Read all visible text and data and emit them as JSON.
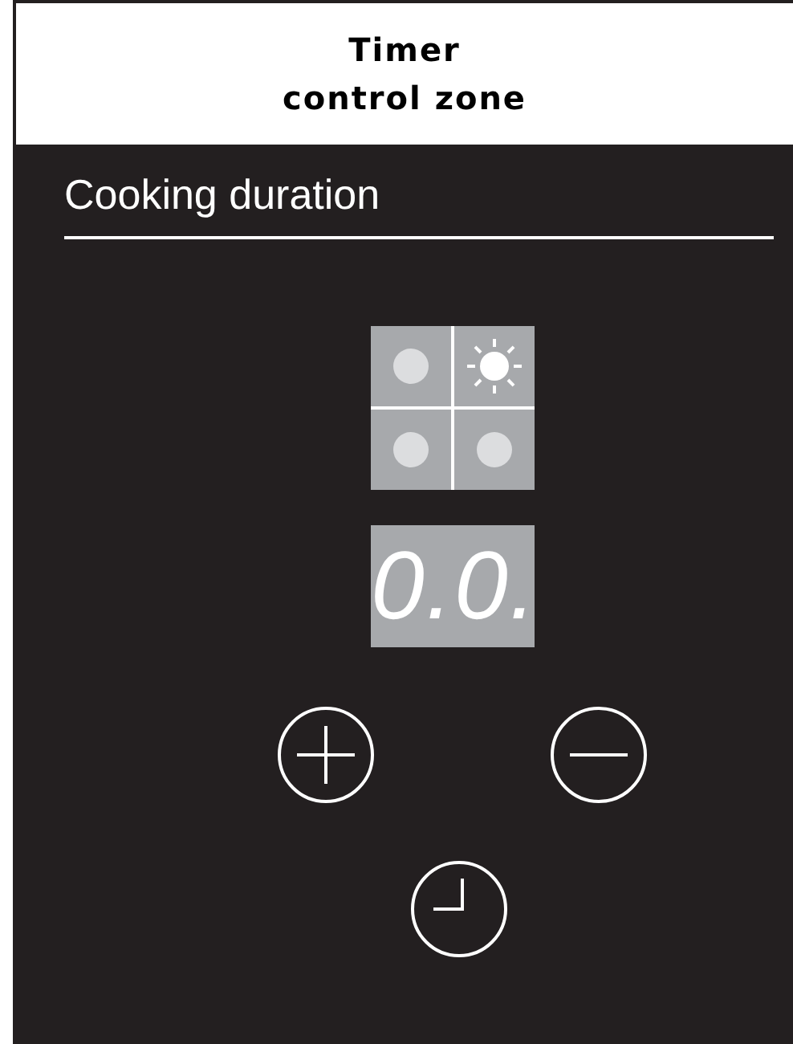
{
  "header": {
    "title_lines": [
      "Timer",
      "control zone"
    ]
  },
  "panel": {
    "title": "Cooking duration",
    "zones": [
      {
        "selected": false
      },
      {
        "selected": true
      },
      {
        "selected": false
      },
      {
        "selected": false
      }
    ],
    "display": "0.0.",
    "buttons": [
      {
        "kind": "plus"
      },
      {
        "kind": "minus"
      },
      {
        "kind": "clock"
      }
    ]
  }
}
